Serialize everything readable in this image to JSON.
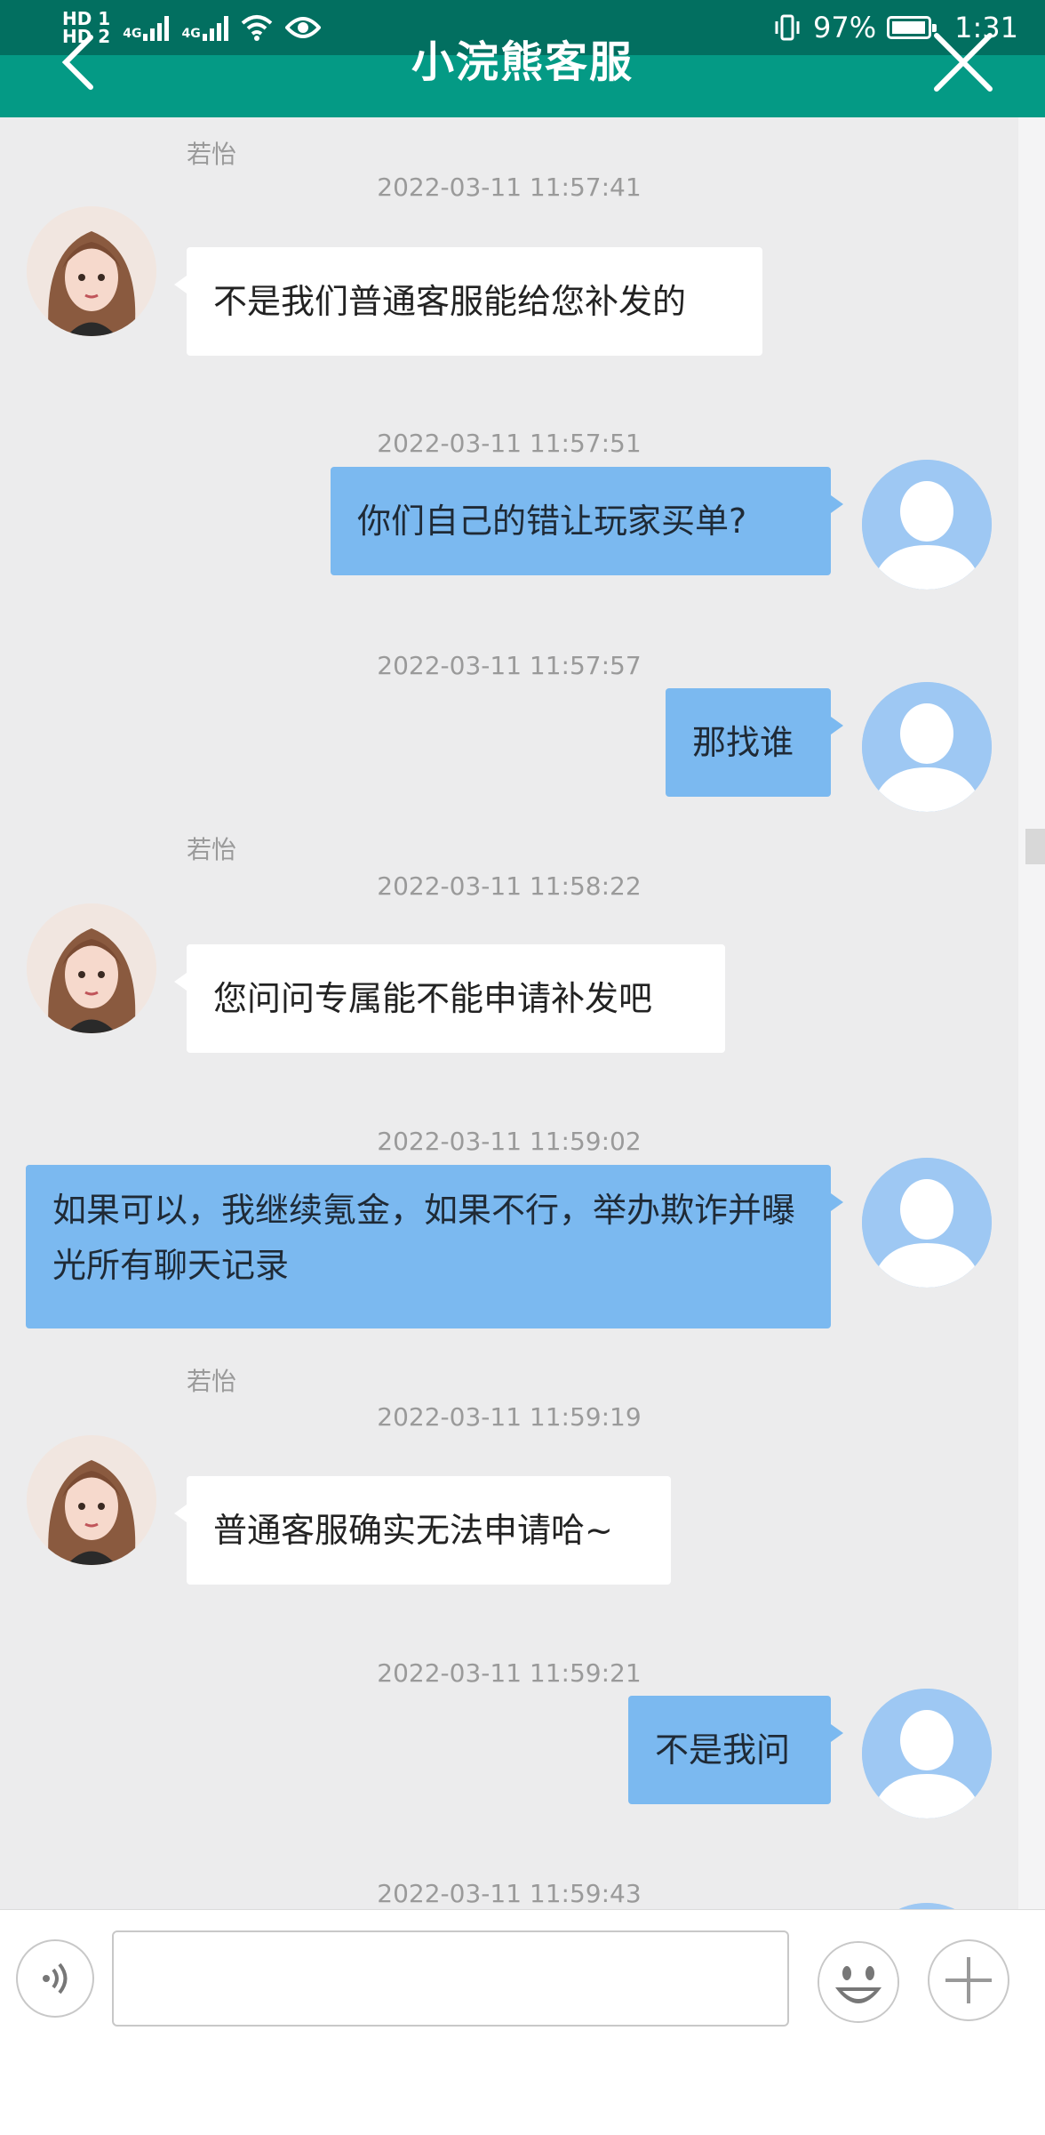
{
  "status_bar": {
    "sim1": "HD 1",
    "sim2": "HD 2",
    "network1": "4G",
    "network2": "4G",
    "battery": "97%",
    "time": "1:31"
  },
  "header": {
    "title": "小浣熊客服"
  },
  "chat": {
    "agent_name": "若怡",
    "messages": [
      {
        "sender": "agent",
        "timestamp": "2022-03-11 11:57:41",
        "text": "不是我们普通客服能给您补发的"
      },
      {
        "sender": "user",
        "timestamp": "2022-03-11 11:57:51",
        "text": "你们自己的错让玩家买单?"
      },
      {
        "sender": "user",
        "timestamp": "2022-03-11 11:57:57",
        "text": "那找谁"
      },
      {
        "sender": "agent",
        "timestamp": "2022-03-11 11:58:22",
        "text": "您问问专属能不能申请补发吧"
      },
      {
        "sender": "user",
        "timestamp": "2022-03-11 11:59:02",
        "text": "如果可以，我继续氪金，如果不行，举办欺诈并曝光所有聊天记录"
      },
      {
        "sender": "agent",
        "timestamp": "2022-03-11 11:59:19",
        "text": "普通客服确实无法申请哈~"
      },
      {
        "sender": "user",
        "timestamp": "2022-03-11 11:59:21",
        "text": "不是我问"
      },
      {
        "sender": "user",
        "timestamp": "2022-03-11 11:59:43",
        "text": ""
      }
    ]
  },
  "input_bar": {
    "placeholder": ""
  },
  "colors": {
    "header": "#049a85",
    "user_bubble": "#7bb9f0",
    "agent_bubble": "#ffffff",
    "background": "#ececed"
  },
  "icons": [
    "back-arrow-icon",
    "close-icon",
    "voice-icon",
    "emoji-icon",
    "plus-icon",
    "wifi-icon",
    "eye-icon",
    "vibrate-icon"
  ]
}
